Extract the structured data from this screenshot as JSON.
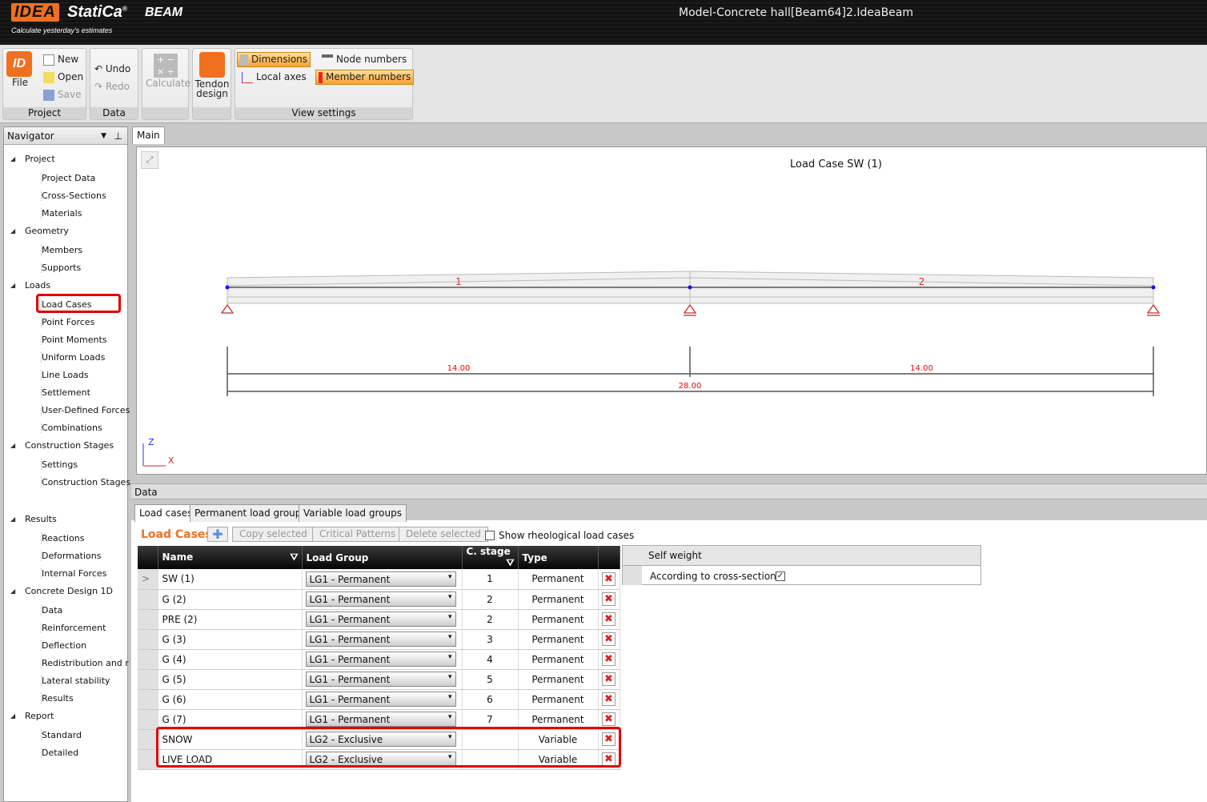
{
  "app": {
    "logo_brand": "IDEA StatiCa",
    "product": "BEAM",
    "tagline": "Calculate yesterday's estimates",
    "window_title": "Model-Concrete hall[Beam64]2.IdeaBeam"
  },
  "ribbon": {
    "groups": [
      {
        "label": "Project"
      },
      {
        "label": "Data"
      },
      {
        "label": ""
      },
      {
        "label": ""
      },
      {
        "label": "View settings"
      }
    ],
    "file": "File",
    "new": "New",
    "open": "Open",
    "save": "Save",
    "undo": "Undo",
    "redo": "Redo",
    "calculate": "Calculate",
    "tendon": "Tendon design",
    "dimensions": "Dimensions",
    "local_axes": "Local axes",
    "node_numbers": "Node numbers",
    "member_numbers": "Member numbers"
  },
  "navigator": {
    "title": "Navigator",
    "items": [
      {
        "label": "Project",
        "level": 0
      },
      {
        "label": "Project Data",
        "level": 1
      },
      {
        "label": "Cross-Sections",
        "level": 1
      },
      {
        "label": "Materials",
        "level": 1
      },
      {
        "label": "Geometry",
        "level": 0
      },
      {
        "label": "Members",
        "level": 1
      },
      {
        "label": "Supports",
        "level": 1
      },
      {
        "label": "Loads",
        "level": 0
      },
      {
        "label": "Load Cases",
        "level": 1,
        "selected": true
      },
      {
        "label": "Point Forces",
        "level": 1
      },
      {
        "label": "Point Moments",
        "level": 1
      },
      {
        "label": "Uniform Loads",
        "level": 1
      },
      {
        "label": "Line Loads",
        "level": 1
      },
      {
        "label": "Settlement",
        "level": 1
      },
      {
        "label": "User-Defined Forces",
        "level": 1
      },
      {
        "label": "Combinations",
        "level": 1
      },
      {
        "label": "Construction Stages",
        "level": 0
      },
      {
        "label": "Settings",
        "level": 1
      },
      {
        "label": "Construction Stages",
        "level": 1
      },
      {
        "label": "Results",
        "level": 0
      },
      {
        "label": "Reactions",
        "level": 1
      },
      {
        "label": "Deformations",
        "level": 1
      },
      {
        "label": "Internal Forces",
        "level": 1
      },
      {
        "label": "Concrete Design 1D",
        "level": 0
      },
      {
        "label": "Data",
        "level": 1
      },
      {
        "label": "Reinforcement",
        "level": 1
      },
      {
        "label": "Deflection",
        "level": 1
      },
      {
        "label": "Redistribution and r",
        "level": 1
      },
      {
        "label": "Lateral stability",
        "level": 1
      },
      {
        "label": "Results",
        "level": 1
      },
      {
        "label": "Report",
        "level": 0
      },
      {
        "label": "Standard",
        "level": 1
      },
      {
        "label": "Detailed",
        "level": 1
      }
    ]
  },
  "main": {
    "tab": "Main",
    "view_title": "Load Case SW (1)",
    "members": [
      "1",
      "2"
    ],
    "spans": [
      "14.00",
      "14.00"
    ],
    "total": "28.00",
    "axis_z": "Z",
    "axis_x": "X"
  },
  "data_panel": {
    "title": "Data",
    "tabs": [
      "Load cases",
      "Permanent load groups",
      "Variable load groups"
    ],
    "section_title": "Load Cases",
    "copy": "Copy selected",
    "critical": "Critical Patterns",
    "delete": "Delete selected",
    "show_rheo": "Show rheological load cases",
    "columns": [
      "Name",
      "Load Group",
      "C. stage",
      "Type"
    ],
    "rows": [
      {
        "name": "SW (1)",
        "group": "LG1 - Permanent",
        "stage": "1",
        "type": "Permanent"
      },
      {
        "name": "G (2)",
        "group": "LG1 - Permanent",
        "stage": "2",
        "type": "Permanent"
      },
      {
        "name": "PRE (2)",
        "group": "LG1 - Permanent",
        "stage": "2",
        "type": "Permanent"
      },
      {
        "name": "G (3)",
        "group": "LG1 - Permanent",
        "stage": "3",
        "type": "Permanent"
      },
      {
        "name": "G (4)",
        "group": "LG1 - Permanent",
        "stage": "4",
        "type": "Permanent"
      },
      {
        "name": "G (5)",
        "group": "LG1 - Permanent",
        "stage": "5",
        "type": "Permanent"
      },
      {
        "name": "G (6)",
        "group": "LG1 - Permanent",
        "stage": "6",
        "type": "Permanent"
      },
      {
        "name": "G (7)",
        "group": "LG1 - Permanent",
        "stage": "7",
        "type": "Permanent"
      },
      {
        "name": "SNOW",
        "group": "LG2 - Exclusive",
        "stage": "",
        "type": "Variable"
      },
      {
        "name": "LIVE LOAD",
        "group": "LG2 - Exclusive",
        "stage": "",
        "type": "Variable"
      }
    ],
    "self_weight": {
      "title": "Self weight",
      "option": "According to cross-section",
      "checked": true
    }
  },
  "colors": {
    "accent": "#f07020",
    "highlight": "#e00000"
  }
}
